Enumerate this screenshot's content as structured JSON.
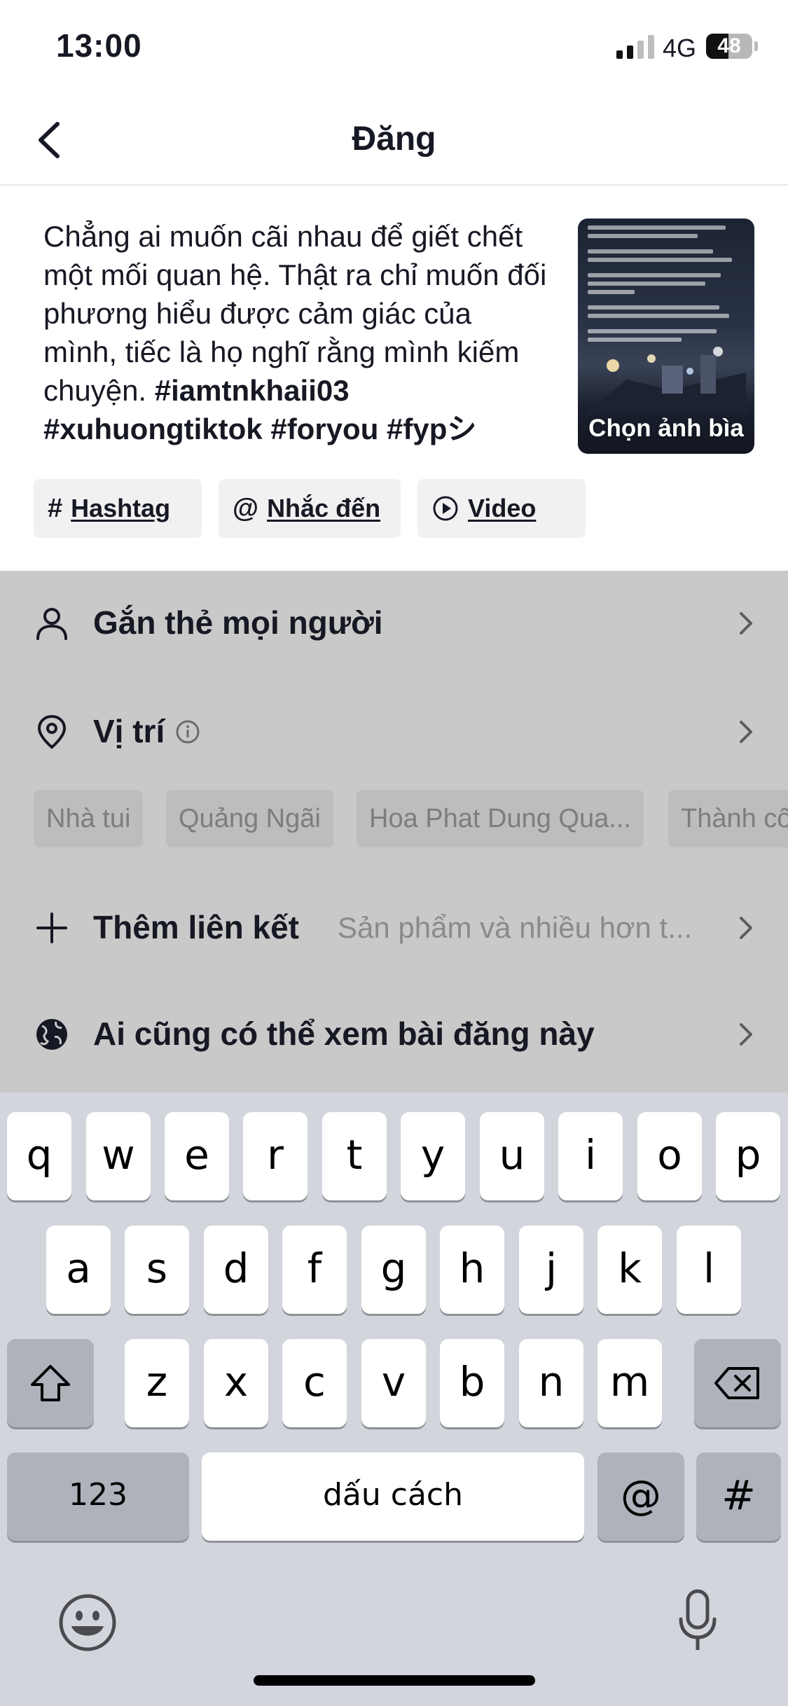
{
  "status_bar": {
    "time": "13:00",
    "network": "4G",
    "battery": "48",
    "battery_level": 0.48
  },
  "nav": {
    "title": "Đăng"
  },
  "caption": {
    "text": "Chẳng ai muốn cãi nhau để giết chết một mối quan hệ. Thật ra chỉ muốn đối phương hiểu được cảm giác của mình, tiếc là họ nghĩ rằng mình kiếm chuyện.",
    "hashtags": "#iamtnkhaii03 #xuhuongtiktok #foryou #fypシ"
  },
  "cover": {
    "label": "Chọn ảnh bìa"
  },
  "chips": [
    {
      "icon": "#",
      "label": "Hashtag"
    },
    {
      "icon": "@",
      "label": "Nhắc đến"
    },
    {
      "icon": "▶",
      "label": "Video"
    }
  ],
  "settings": {
    "tag_people": "Gắn thẻ mọi người",
    "location": "Vị trí",
    "location_suggestions": [
      "Nhà tui",
      "Quảng Ngãi",
      "Hoa Phat Dung Qua...",
      "Thành cố"
    ],
    "add_link": "Thêm liên kết",
    "add_link_hint": "Sản phẩm và nhiều hơn t...",
    "visibility": "Ai cũng có thể xem bài đăng này"
  },
  "keyboard": {
    "row1": [
      "q",
      "w",
      "e",
      "r",
      "t",
      "y",
      "u",
      "i",
      "o",
      "p"
    ],
    "row2": [
      "a",
      "s",
      "d",
      "f",
      "g",
      "h",
      "j",
      "k",
      "l"
    ],
    "row3": [
      "z",
      "x",
      "c",
      "v",
      "b",
      "n",
      "m"
    ],
    "numbers": "123",
    "space": "dấu cách",
    "at": "@",
    "hash": "#"
  }
}
